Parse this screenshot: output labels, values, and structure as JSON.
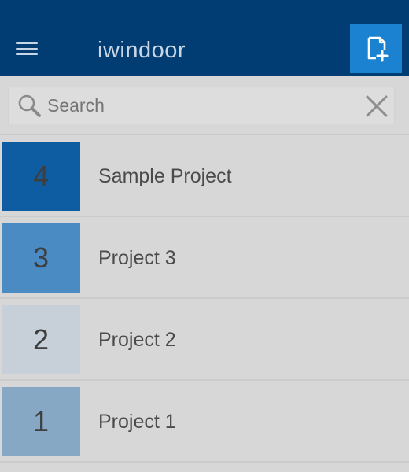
{
  "appbar": {
    "title": "iwindoor",
    "menu_icon": "hamburger-menu-icon",
    "new_project_icon": "new-document-plus-icon",
    "background_color": "#013d73",
    "action_color": "#1a82d0"
  },
  "search": {
    "placeholder": "Search",
    "value": "",
    "search_icon": "magnifier-icon",
    "clear_icon": "close-icon"
  },
  "projects": [
    {
      "number": "4",
      "name": "Sample Project",
      "color": "#0e5da2"
    },
    {
      "number": "3",
      "name": "Project 3",
      "color": "#4a8bc4"
    },
    {
      "number": "2",
      "name": "Project 2",
      "color": "#c7d0d9"
    },
    {
      "number": "1",
      "name": "Project 1",
      "color": "#86a8c4"
    }
  ]
}
